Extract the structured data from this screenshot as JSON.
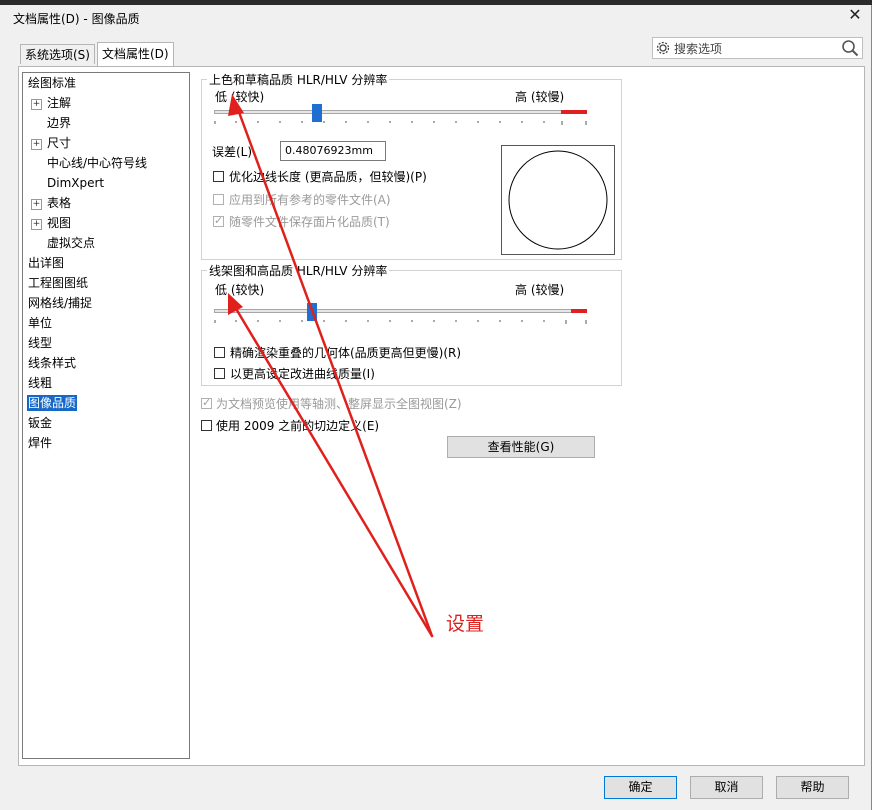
{
  "window": {
    "title": "文档属性(D) - 图像品质",
    "close_glyph": "✕"
  },
  "tabs": [
    {
      "label": "系统选项(S)",
      "active": false
    },
    {
      "label": "文档属性(D)",
      "active": true
    }
  ],
  "search": {
    "placeholder": "搜索选项"
  },
  "tree": {
    "items": [
      {
        "label": "绘图标准",
        "expander": false
      },
      {
        "label": "注解",
        "expander": true
      },
      {
        "label": "边界",
        "expander": false
      },
      {
        "label": "尺寸",
        "expander": true
      },
      {
        "label": "中心线/中心符号线",
        "expander": false
      },
      {
        "label": "DimXpert",
        "expander": false
      },
      {
        "label": "表格",
        "expander": true
      },
      {
        "label": "视图",
        "expander": true
      },
      {
        "label": "虚拟交点",
        "expander": false
      },
      {
        "label": "出详图",
        "expander": false
      },
      {
        "label": "工程图图纸",
        "expander": false
      },
      {
        "label": "网格线/捕捉",
        "expander": false
      },
      {
        "label": "单位",
        "expander": false
      },
      {
        "label": "线型",
        "expander": false
      },
      {
        "label": "线条样式",
        "expander": false
      },
      {
        "label": "线粗",
        "expander": false
      },
      {
        "label": "图像品质",
        "expander": false,
        "selected": true
      },
      {
        "label": "钣金",
        "expander": false
      },
      {
        "label": "焊件",
        "expander": false
      }
    ],
    "expander_glyph": "+"
  },
  "shaded": {
    "title": "上色和草稿品质 HLR/HLV 分辨率",
    "low_label": "低 (较快)",
    "high_label": "高 (较慢)",
    "slider_level": 0.28,
    "deviation_label": "误差(L)",
    "deviation_value": "0.48076923mm",
    "options": [
      {
        "label": "优化边线长度 (更高品质，但较慢)(P)",
        "checked": false,
        "enabled": true
      },
      {
        "label": "应用到所有参考的零件文件(A)",
        "checked": false,
        "enabled": false
      },
      {
        "label": "随零件文件保存面片化品质(T)",
        "checked": true,
        "enabled": false
      }
    ]
  },
  "wireframe": {
    "title": "线架图和高品质 HLR/HLV 分辨率",
    "low_label": "低 (较快)",
    "high_label": "高 (较慢)",
    "slider_level": 0.26,
    "options": [
      {
        "label": "精确渲染重叠的几何体(品质更高但更慢)(R)",
        "checked": false,
        "enabled": true
      },
      {
        "label": "以更高设定改进曲线质量(I)",
        "checked": false,
        "enabled": true
      }
    ]
  },
  "extra_options": [
    {
      "label": "为文档预览使用等轴测、整屏显示全图视图(Z)",
      "checked": true,
      "enabled": false
    },
    {
      "label": "使用 2009 之前的切边定义(E)",
      "checked": false,
      "enabled": true
    }
  ],
  "perf_button": "查看性能(G)",
  "footer": {
    "ok": "确定",
    "cancel": "取消",
    "help": "帮助"
  },
  "annotation": {
    "text": "设置",
    "color": "#e0201c"
  }
}
